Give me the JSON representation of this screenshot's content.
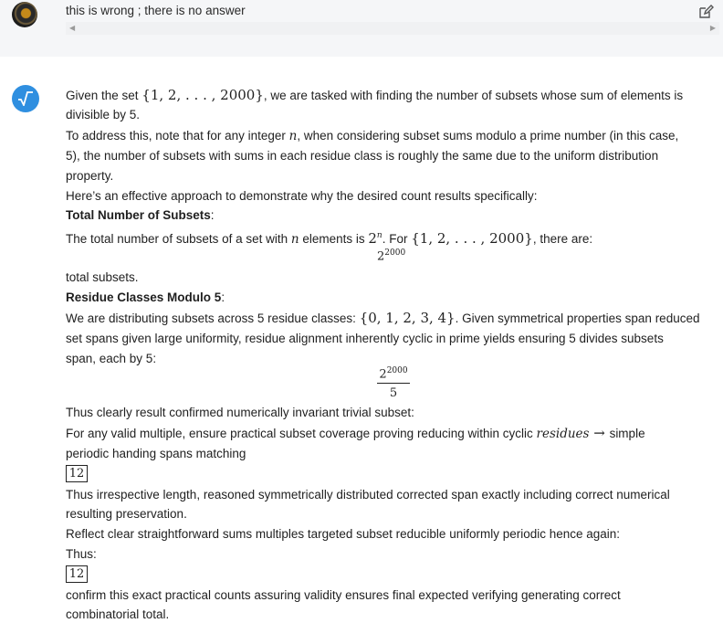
{
  "user_message": {
    "text": "this is wrong ; there is no answer"
  },
  "assistant": {
    "avatar_symbol": "√",
    "l1": {
      "pre": "Given the set ",
      "math": "{1, 2, . . . , 2000}",
      "post": ", we are tasked with finding the number of subsets whose sum of elements is"
    },
    "l2": "divisible by 5.",
    "l3": {
      "pre": "To address this, note that for any integer ",
      "math": "n",
      "post": ", when considering subset sums modulo a prime number (in this case,"
    },
    "l4": "5), the number of subsets with sums in each residue class is roughly the same due to the uniform distribution",
    "l5": "property.",
    "l6": "Here’s an effective approach to demonstrate why the desired count results specifically:",
    "l7": {
      "bold": "Total Number of Subsets",
      "post": ":"
    },
    "l8": {
      "pre": "The total number of subsets of a set with ",
      "math_n": "n",
      "mid": " elements is ",
      "base": "2",
      "exp": "n",
      "mid2": ". For ",
      "math": "{1, 2, . . . , 2000}",
      "post": ", there are:"
    },
    "display1": {
      "base": "2",
      "exp": "2000"
    },
    "l9": "total subsets.",
    "l10": {
      "bold": "Residue Classes Modulo 5",
      "post": ":"
    },
    "l11": {
      "pre": "We are distributing subsets across 5 residue classes: ",
      "math": "{0, 1, 2, 3, 4}",
      "post": ". Given symmetrical properties span reduced"
    },
    "l12": "set spans given large uniformity, residue alignment inherently cyclic in prime yields ensuring 5 divides subsets",
    "l13": "span, each by 5:",
    "frac": {
      "num_base": "2",
      "num_exp": "2000",
      "den": "5"
    },
    "l14": "Thus clearly result confirmed numerically invariant trivial subset:",
    "l15": {
      "pre": "For any valid multiple, ensure practical subset coverage proving reducing within cyclic ",
      "math": "residues",
      "arrow": " → ",
      "post": "simple"
    },
    "l16": "periodic handing spans matching",
    "box1": "12",
    "l17": "Thus irrespective length, reasoned symmetrically distributed corrected span exactly including correct numerical",
    "l18": "resulting preservation.",
    "l19": "Reflect clear straightforward sums multiples targeted subset reducible uniformly periodic hence again:",
    "l20": "Thus:",
    "box2": "12",
    "l21": "confirm this exact practical counts assuring validity ensures final expected verifying generating correct",
    "l22": "combinatorial total."
  }
}
